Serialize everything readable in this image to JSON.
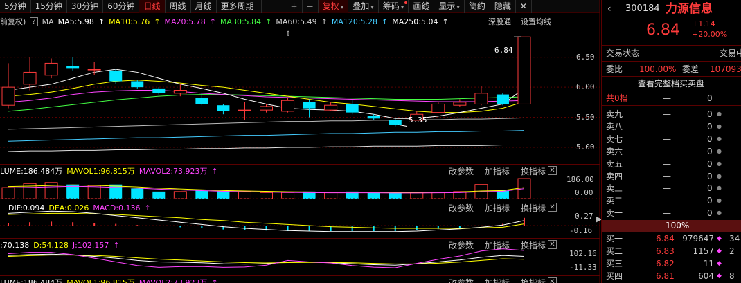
{
  "toolbar": {
    "items": [
      "5分钟",
      "15分钟",
      "30分钟",
      "60分钟",
      "日线",
      "周线",
      "月线",
      "更多周期"
    ],
    "active_index": 4,
    "tools": [
      "+",
      "−",
      "复权",
      "叠加",
      "筹码",
      "画线",
      "显示",
      "简约",
      "隐藏"
    ],
    "close": "✕",
    "restore": "◻"
  },
  "ma_row": {
    "prefix": "前复权)",
    "help": "?",
    "ma_label": "MA",
    "items": [
      {
        "text": "MA5:5.98",
        "color": "#ffffff"
      },
      {
        "text": "MA10:5.76",
        "color": "#ffff00"
      },
      {
        "text": "MA20:5.78",
        "color": "#ff44ff"
      },
      {
        "text": "MA30:5.84",
        "color": "#44ff44"
      },
      {
        "text": "MA60:5.49",
        "color": "#d0d0d0"
      },
      {
        "text": "MA120:5.28",
        "color": "#44ccff"
      },
      {
        "text": "MA250:5.04",
        "color": "#ffffff"
      }
    ],
    "right1": "深股通",
    "right2": "设置均线"
  },
  "price_axis": [
    "6.50",
    "6.00",
    "5.50",
    "5.00"
  ],
  "annotations": {
    "high": "6.84",
    "low": "5.35"
  },
  "chart_data": {
    "type": "candlestick",
    "ylim": [
      4.85,
      6.9
    ],
    "candles": [
      {
        "o": 5.7,
        "c": 6.0,
        "h": 6.4,
        "l": 5.65
      },
      {
        "o": 6.05,
        "c": 6.25,
        "h": 6.5,
        "l": 5.95
      },
      {
        "o": 6.2,
        "c": 6.4,
        "h": 6.48,
        "l": 6.15
      },
      {
        "o": 6.35,
        "c": 6.32,
        "h": 6.5,
        "l": 6.28
      },
      {
        "o": 6.3,
        "c": 6.3,
        "h": 6.42,
        "l": 6.2
      },
      {
        "o": 6.28,
        "c": 6.1,
        "h": 6.3,
        "l": 6.05
      },
      {
        "o": 6.1,
        "c": 6.0,
        "h": 6.12,
        "l": 5.98
      },
      {
        "o": 5.98,
        "c": 5.9,
        "h": 6.0,
        "l": 5.88
      },
      {
        "o": 5.9,
        "c": 5.95,
        "h": 6.05,
        "l": 5.85
      },
      {
        "o": 5.82,
        "c": 5.72,
        "h": 5.9,
        "l": 5.7
      },
      {
        "o": 5.7,
        "c": 5.6,
        "h": 5.72,
        "l": 5.55
      },
      {
        "o": 5.62,
        "c": 5.62,
        "h": 5.75,
        "l": 5.45
      },
      {
        "o": 5.62,
        "c": 5.68,
        "h": 5.72,
        "l": 5.58
      },
      {
        "o": 5.6,
        "c": 5.78,
        "h": 5.82,
        "l": 5.58
      },
      {
        "o": 5.75,
        "c": 5.65,
        "h": 5.8,
        "l": 5.5
      },
      {
        "o": 5.62,
        "c": 5.7,
        "h": 5.75,
        "l": 5.6
      },
      {
        "o": 5.72,
        "c": 5.58,
        "h": 5.78,
        "l": 5.55
      },
      {
        "o": 5.52,
        "c": 5.48,
        "h": 5.55,
        "l": 5.45
      },
      {
        "o": 5.45,
        "c": 5.38,
        "h": 5.48,
        "l": 5.35
      },
      {
        "o": 5.45,
        "c": 5.55,
        "h": 5.6,
        "l": 5.45
      },
      {
        "o": 5.58,
        "c": 5.72,
        "h": 5.75,
        "l": 5.58
      },
      {
        "o": 5.7,
        "c": 5.75,
        "h": 5.8,
        "l": 5.68
      },
      {
        "o": 5.72,
        "c": 5.9,
        "h": 6.02,
        "l": 5.7
      },
      {
        "o": 5.88,
        "c": 5.72,
        "h": 5.9,
        "l": 5.7
      },
      {
        "o": 5.72,
        "c": 6.84,
        "h": 6.84,
        "l": 5.72
      }
    ],
    "ma5": [
      5.95,
      6.0,
      6.05,
      6.15,
      6.25,
      6.3,
      6.25,
      6.15,
      6.05,
      5.98,
      5.9,
      5.8,
      5.72,
      5.65,
      5.63,
      5.62,
      5.6,
      5.55,
      5.48,
      5.48,
      5.52,
      5.58,
      5.65,
      5.72,
      5.98
    ],
    "ma10": [
      5.85,
      5.88,
      5.92,
      5.98,
      6.05,
      6.1,
      6.12,
      6.1,
      6.07,
      6.03,
      6.0,
      5.95,
      5.9,
      5.85,
      5.8,
      5.75,
      5.72,
      5.68,
      5.64,
      5.6,
      5.58,
      5.58,
      5.6,
      5.65,
      5.76
    ],
    "ma20": [
      5.75,
      5.78,
      5.82,
      5.88,
      5.92,
      5.94,
      5.95,
      5.95,
      5.93,
      5.9,
      5.88,
      5.86,
      5.84,
      5.83,
      5.82,
      5.81,
      5.8,
      5.79,
      5.78,
      5.77,
      5.76,
      5.76,
      5.76,
      5.77,
      5.78
    ],
    "ma30": [
      5.6,
      5.63,
      5.67,
      5.71,
      5.75,
      5.79,
      5.82,
      5.85,
      5.87,
      5.88,
      5.88,
      5.87,
      5.86,
      5.85,
      5.84,
      5.83,
      5.82,
      5.81,
      5.8,
      5.8,
      5.8,
      5.81,
      5.82,
      5.83,
      5.84
    ],
    "ma60": [
      5.3,
      5.31,
      5.32,
      5.33,
      5.34,
      5.35,
      5.36,
      5.37,
      5.38,
      5.39,
      5.4,
      5.41,
      5.42,
      5.43,
      5.43,
      5.44,
      5.44,
      5.45,
      5.45,
      5.46,
      5.46,
      5.47,
      5.47,
      5.48,
      5.49
    ],
    "ma120": [
      5.1,
      5.11,
      5.12,
      5.13,
      5.14,
      5.15,
      5.16,
      5.16,
      5.17,
      5.18,
      5.19,
      5.2,
      5.2,
      5.21,
      5.22,
      5.23,
      5.23,
      5.24,
      5.25,
      5.25,
      5.26,
      5.26,
      5.27,
      5.27,
      5.28
    ],
    "ma250": [
      4.93,
      4.94,
      4.94,
      4.95,
      4.95,
      4.96,
      4.96,
      4.97,
      4.97,
      4.98,
      4.98,
      4.99,
      4.99,
      5.0,
      5.0,
      5.01,
      5.01,
      5.02,
      5.02,
      5.02,
      5.03,
      5.03,
      5.03,
      5.04,
      5.04
    ],
    "volume": [
      0.55,
      0.75,
      0.8,
      0.7,
      0.65,
      0.7,
      0.5,
      0.35,
      0.35,
      0.4,
      0.38,
      0.35,
      0.3,
      0.3,
      0.35,
      0.32,
      0.35,
      0.3,
      0.28,
      0.3,
      0.32,
      0.35,
      0.7,
      0.4,
      1.0
    ],
    "vol_ma": [
      0.6,
      0.62,
      0.65,
      0.68,
      0.66,
      0.62,
      0.58,
      0.52,
      0.48,
      0.44,
      0.4,
      0.38,
      0.36,
      0.34,
      0.33,
      0.32,
      0.32,
      0.32,
      0.31,
      0.31,
      0.32,
      0.33,
      0.38,
      0.4,
      0.55
    ],
    "macd": [
      0.05,
      0.06,
      0.07,
      0.06,
      0.05,
      0.03,
      0.01,
      -0.01,
      -0.03,
      -0.05,
      -0.07,
      -0.08,
      -0.09,
      -0.1,
      -0.1,
      -0.1,
      -0.1,
      -0.1,
      -0.1,
      -0.08,
      -0.06,
      -0.04,
      -0.01,
      0.03,
      0.14
    ],
    "dif": [
      0.22,
      0.24,
      0.26,
      0.25,
      0.22,
      0.18,
      0.14,
      0.1,
      0.06,
      0.02,
      -0.02,
      -0.05,
      -0.07,
      -0.09,
      -0.1,
      -0.11,
      -0.11,
      -0.11,
      -0.11,
      -0.1,
      -0.08,
      -0.06,
      -0.03,
      0.01,
      0.09
    ],
    "dea": [
      0.2,
      0.21,
      0.22,
      0.22,
      0.21,
      0.2,
      0.18,
      0.16,
      0.14,
      0.11,
      0.09,
      0.06,
      0.04,
      0.02,
      0.0,
      -0.02,
      -0.03,
      -0.04,
      -0.05,
      -0.05,
      -0.05,
      -0.05,
      -0.04,
      -0.03,
      0.03
    ],
    "k": [
      75,
      80,
      82,
      78,
      70,
      60,
      48,
      40,
      38,
      35,
      30,
      28,
      30,
      40,
      38,
      36,
      30,
      25,
      22,
      30,
      40,
      50,
      65,
      75,
      70
    ],
    "d": [
      70,
      74,
      77,
      77,
      75,
      70,
      62,
      55,
      50,
      45,
      40,
      36,
      34,
      36,
      37,
      37,
      35,
      32,
      29,
      29,
      33,
      39,
      48,
      57,
      54
    ],
    "j": [
      85,
      92,
      92,
      80,
      60,
      40,
      20,
      10,
      14,
      15,
      10,
      12,
      22,
      48,
      40,
      34,
      20,
      11,
      8,
      32,
      54,
      72,
      99,
      111,
      102
    ]
  },
  "volume_panel": {
    "title": "LUME:186.484万",
    "mavol1": "MAVOL1:96.815万",
    "mavol2": "MAVOL2:73.923万",
    "axis": [
      "186.00",
      "0.00"
    ],
    "buttons": [
      "改参数",
      "加指标",
      "换指标"
    ]
  },
  "macd_panel": {
    "dif": "DIF:0.094",
    "dea": "DEA:0.026",
    "macd": "MACD:0.136",
    "axis": [
      "0.27",
      "-0.16"
    ],
    "buttons": [
      "改参数",
      "加指标",
      "换指标"
    ]
  },
  "kdj_panel": {
    "k": ":70.138",
    "d": "D:54.128",
    "j": "J:102.157",
    "axis": [
      "102.16",
      "-11.33"
    ],
    "buttons": [
      "改参数",
      "加指标",
      "换指标"
    ]
  },
  "vol_panel2": {
    "title": "LUME:186.484万",
    "mavol1": "MAVOL1:96.815万",
    "mavol2": "MAVOL2:73.923万",
    "buttons": [
      "改参数",
      "加指标",
      "换指标"
    ]
  },
  "quote": {
    "code": "300184",
    "name": "力源信息",
    "price": "6.84",
    "change": "+1.14",
    "pct": "+20.00%",
    "status_label": "交易状态",
    "status_value": "交易中",
    "weibi_label": "委比",
    "weibi_value": "100.00%",
    "weicha_label": "委差",
    "weicha_value": "107093",
    "full_book": "查看完整档买卖盘",
    "total_label": "共0档",
    "total_dash": "—",
    "total_value": "0",
    "sells": [
      {
        "label": "卖九",
        "price": "—",
        "vol": "0"
      },
      {
        "label": "卖八",
        "price": "—",
        "vol": "0"
      },
      {
        "label": "卖七",
        "price": "—",
        "vol": "0"
      },
      {
        "label": "卖六",
        "price": "—",
        "vol": "0"
      },
      {
        "label": "卖五",
        "price": "—",
        "vol": "0"
      },
      {
        "label": "卖四",
        "price": "—",
        "vol": "0"
      },
      {
        "label": "卖三",
        "price": "—",
        "vol": "0"
      },
      {
        "label": "卖二",
        "price": "—",
        "vol": "0"
      },
      {
        "label": "卖一",
        "price": "—",
        "vol": "0"
      }
    ],
    "ratio_bar": "100%",
    "buys": [
      {
        "label": "买一",
        "price": "6.84",
        "vol": "979647",
        "extra": "34"
      },
      {
        "label": "买二",
        "price": "6.83",
        "vol": "1157",
        "extra": "2"
      },
      {
        "label": "买三",
        "price": "6.82",
        "vol": "11",
        "extra": ""
      },
      {
        "label": "买四",
        "price": "6.81",
        "vol": "604",
        "extra": "8"
      }
    ]
  },
  "colors": {
    "up": "#ff3b3b",
    "down": "#00e5ff",
    "grid": "#5a0000"
  }
}
